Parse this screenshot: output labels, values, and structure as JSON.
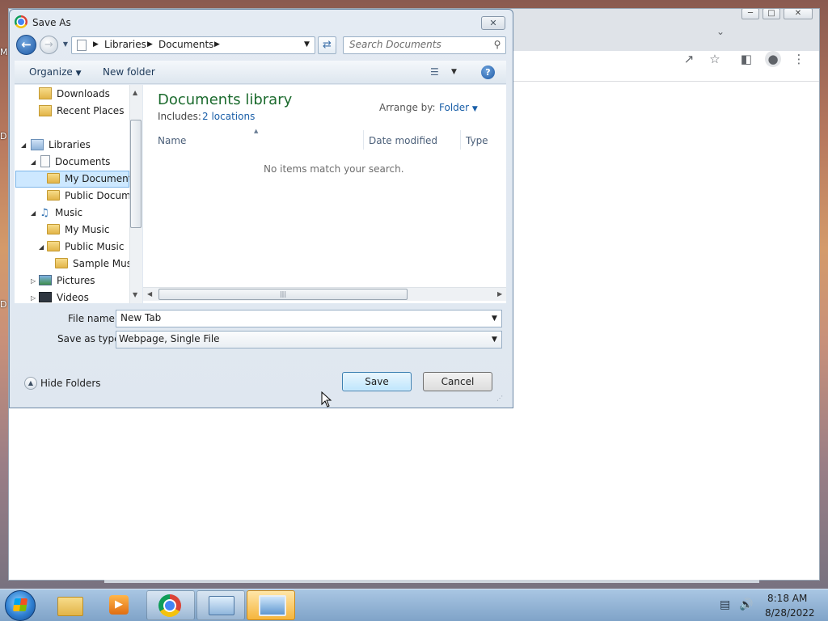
{
  "desktop": {
    "letters": [
      "M",
      "D",
      "D"
    ]
  },
  "dialog": {
    "title": "Save As",
    "close_glyph": "✕",
    "nav": {
      "breadcrumb": [
        "Libraries",
        "Documents"
      ],
      "search_placeholder": "Search Documents"
    },
    "commands": {
      "organize": "Organize",
      "new_folder": "New folder"
    },
    "tree": {
      "downloads": "Downloads",
      "recent": "Recent Places",
      "libraries": "Libraries",
      "documents": "Documents",
      "my_documents": "My Documents",
      "public_documents": "Public Documents",
      "music": "Music",
      "my_music": "My Music",
      "public_music": "Public Music",
      "sample_music": "Sample Music",
      "pictures": "Pictures",
      "videos": "Videos",
      "selected": "My Documents"
    },
    "content": {
      "library_title": "Documents library",
      "includes_label": "Includes:",
      "includes_link": "2 locations",
      "arrange_label": "Arrange by:",
      "arrange_value": "Folder",
      "columns": [
        "Name",
        "Date modified",
        "Type"
      ],
      "empty_message": "No items match your search."
    },
    "file_name_label": "File name:",
    "file_name_value": "New Tab",
    "save_type_label": "Save as type:",
    "save_type_value": "Webpage, Single File",
    "hide_folders": "Hide Folders",
    "save_button": "Save",
    "cancel_button": "Cancel"
  },
  "taskbar": {
    "time": "8:18 AM",
    "date": "8/28/2022",
    "buttons": [
      "explorer",
      "media-player",
      "chrome",
      "control-panel",
      "remote-desktop"
    ],
    "active": "remote-desktop"
  },
  "colors": {
    "library_title": "#1c6b2e",
    "link": "#1a5fa8",
    "selection": "#cde8ff",
    "taskbar": "#7fa3c8"
  }
}
